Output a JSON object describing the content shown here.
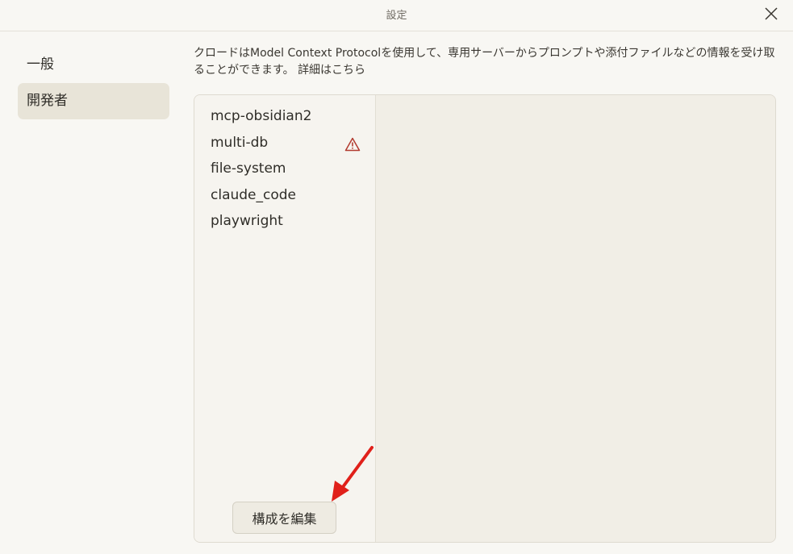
{
  "window": {
    "title": "設定"
  },
  "sidebar": {
    "items": [
      {
        "label": "一般"
      },
      {
        "label": "開発者"
      }
    ]
  },
  "description": {
    "text": "クロードはModel Context Protocolを使用して、専用サーバーからプロンプトや添付ファイルなどの情報を受け取ることができます。",
    "link": "詳細はこちら"
  },
  "servers": [
    {
      "name": "mcp-obsidian2",
      "warning": false
    },
    {
      "name": "multi-db",
      "warning": true
    },
    {
      "name": "file-system",
      "warning": false
    },
    {
      "name": "claude_code",
      "warning": false
    },
    {
      "name": "playwright",
      "warning": false
    }
  ],
  "edit_button": {
    "label": "構成を編集"
  },
  "colors": {
    "warning": "#b23a2f",
    "annotation_arrow": "#e0201a",
    "active_nav": "#e8e4d8"
  },
  "icons": {
    "close": "close-icon",
    "warning": "warning-icon",
    "annotation": "red-arrow-annotation"
  }
}
